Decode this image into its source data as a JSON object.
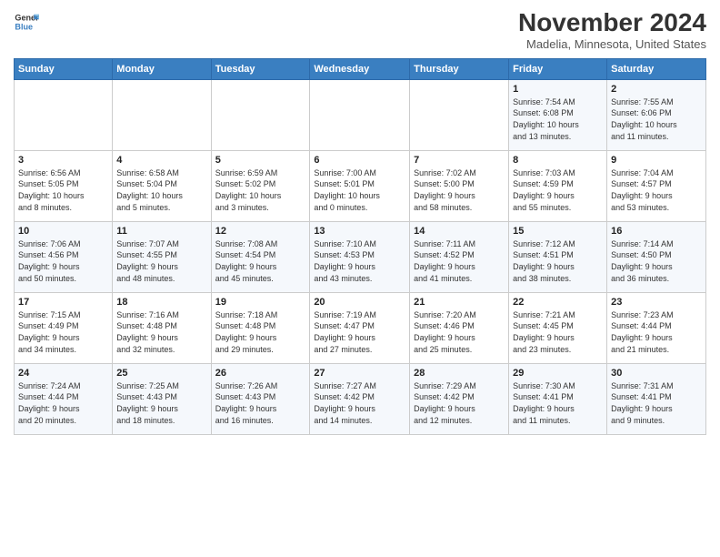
{
  "logo": {
    "line1": "General",
    "line2": "Blue"
  },
  "title": "November 2024",
  "location": "Madelia, Minnesota, United States",
  "weekdays": [
    "Sunday",
    "Monday",
    "Tuesday",
    "Wednesday",
    "Thursday",
    "Friday",
    "Saturday"
  ],
  "weeks": [
    [
      {
        "day": "",
        "info": ""
      },
      {
        "day": "",
        "info": ""
      },
      {
        "day": "",
        "info": ""
      },
      {
        "day": "",
        "info": ""
      },
      {
        "day": "",
        "info": ""
      },
      {
        "day": "1",
        "info": "Sunrise: 7:54 AM\nSunset: 6:08 PM\nDaylight: 10 hours\nand 13 minutes."
      },
      {
        "day": "2",
        "info": "Sunrise: 7:55 AM\nSunset: 6:06 PM\nDaylight: 10 hours\nand 11 minutes."
      }
    ],
    [
      {
        "day": "3",
        "info": "Sunrise: 6:56 AM\nSunset: 5:05 PM\nDaylight: 10 hours\nand 8 minutes."
      },
      {
        "day": "4",
        "info": "Sunrise: 6:58 AM\nSunset: 5:04 PM\nDaylight: 10 hours\nand 5 minutes."
      },
      {
        "day": "5",
        "info": "Sunrise: 6:59 AM\nSunset: 5:02 PM\nDaylight: 10 hours\nand 3 minutes."
      },
      {
        "day": "6",
        "info": "Sunrise: 7:00 AM\nSunset: 5:01 PM\nDaylight: 10 hours\nand 0 minutes."
      },
      {
        "day": "7",
        "info": "Sunrise: 7:02 AM\nSunset: 5:00 PM\nDaylight: 9 hours\nand 58 minutes."
      },
      {
        "day": "8",
        "info": "Sunrise: 7:03 AM\nSunset: 4:59 PM\nDaylight: 9 hours\nand 55 minutes."
      },
      {
        "day": "9",
        "info": "Sunrise: 7:04 AM\nSunset: 4:57 PM\nDaylight: 9 hours\nand 53 minutes."
      }
    ],
    [
      {
        "day": "10",
        "info": "Sunrise: 7:06 AM\nSunset: 4:56 PM\nDaylight: 9 hours\nand 50 minutes."
      },
      {
        "day": "11",
        "info": "Sunrise: 7:07 AM\nSunset: 4:55 PM\nDaylight: 9 hours\nand 48 minutes."
      },
      {
        "day": "12",
        "info": "Sunrise: 7:08 AM\nSunset: 4:54 PM\nDaylight: 9 hours\nand 45 minutes."
      },
      {
        "day": "13",
        "info": "Sunrise: 7:10 AM\nSunset: 4:53 PM\nDaylight: 9 hours\nand 43 minutes."
      },
      {
        "day": "14",
        "info": "Sunrise: 7:11 AM\nSunset: 4:52 PM\nDaylight: 9 hours\nand 41 minutes."
      },
      {
        "day": "15",
        "info": "Sunrise: 7:12 AM\nSunset: 4:51 PM\nDaylight: 9 hours\nand 38 minutes."
      },
      {
        "day": "16",
        "info": "Sunrise: 7:14 AM\nSunset: 4:50 PM\nDaylight: 9 hours\nand 36 minutes."
      }
    ],
    [
      {
        "day": "17",
        "info": "Sunrise: 7:15 AM\nSunset: 4:49 PM\nDaylight: 9 hours\nand 34 minutes."
      },
      {
        "day": "18",
        "info": "Sunrise: 7:16 AM\nSunset: 4:48 PM\nDaylight: 9 hours\nand 32 minutes."
      },
      {
        "day": "19",
        "info": "Sunrise: 7:18 AM\nSunset: 4:48 PM\nDaylight: 9 hours\nand 29 minutes."
      },
      {
        "day": "20",
        "info": "Sunrise: 7:19 AM\nSunset: 4:47 PM\nDaylight: 9 hours\nand 27 minutes."
      },
      {
        "day": "21",
        "info": "Sunrise: 7:20 AM\nSunset: 4:46 PM\nDaylight: 9 hours\nand 25 minutes."
      },
      {
        "day": "22",
        "info": "Sunrise: 7:21 AM\nSunset: 4:45 PM\nDaylight: 9 hours\nand 23 minutes."
      },
      {
        "day": "23",
        "info": "Sunrise: 7:23 AM\nSunset: 4:44 PM\nDaylight: 9 hours\nand 21 minutes."
      }
    ],
    [
      {
        "day": "24",
        "info": "Sunrise: 7:24 AM\nSunset: 4:44 PM\nDaylight: 9 hours\nand 20 minutes."
      },
      {
        "day": "25",
        "info": "Sunrise: 7:25 AM\nSunset: 4:43 PM\nDaylight: 9 hours\nand 18 minutes."
      },
      {
        "day": "26",
        "info": "Sunrise: 7:26 AM\nSunset: 4:43 PM\nDaylight: 9 hours\nand 16 minutes."
      },
      {
        "day": "27",
        "info": "Sunrise: 7:27 AM\nSunset: 4:42 PM\nDaylight: 9 hours\nand 14 minutes."
      },
      {
        "day": "28",
        "info": "Sunrise: 7:29 AM\nSunset: 4:42 PM\nDaylight: 9 hours\nand 12 minutes."
      },
      {
        "day": "29",
        "info": "Sunrise: 7:30 AM\nSunset: 4:41 PM\nDaylight: 9 hours\nand 11 minutes."
      },
      {
        "day": "30",
        "info": "Sunrise: 7:31 AM\nSunset: 4:41 PM\nDaylight: 9 hours\nand 9 minutes."
      }
    ]
  ]
}
